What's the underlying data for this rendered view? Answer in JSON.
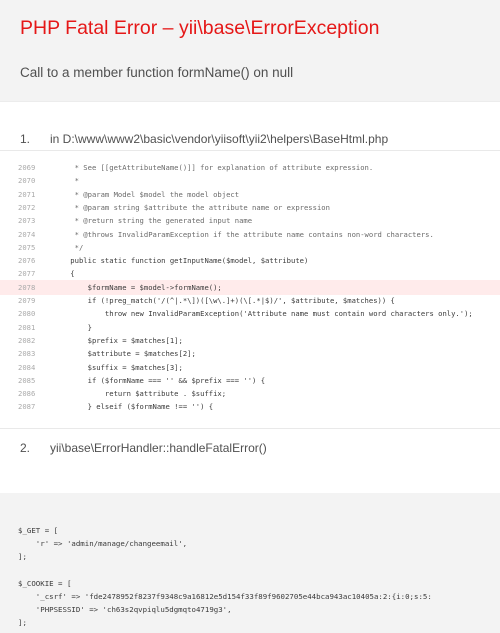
{
  "header": {
    "title": "PHP Fatal Error – yii\\base\\ErrorException",
    "message": "Call to a member function formName() on null"
  },
  "callstack": [
    {
      "num": "1.",
      "text": "in D:\\www\\www2\\basic\\vendor\\yiisoft\\yii2\\helpers\\BaseHtml.php"
    },
    {
      "num": "2.",
      "text": "yii\\base\\ErrorHandler::handleFatalError()"
    }
  ],
  "code_lines": [
    {
      "ln": "2069",
      "src": "     * See [[getAttributeName()]] for explanation of attribute expression."
    },
    {
      "ln": "2070",
      "src": "     *"
    },
    {
      "ln": "2071",
      "src": "     * @param Model $model the model object"
    },
    {
      "ln": "2072",
      "src": "     * @param string $attribute the attribute name or expression"
    },
    {
      "ln": "2073",
      "src": "     * @return string the generated input name"
    },
    {
      "ln": "2074",
      "src": "     * @throws InvalidParamException if the attribute name contains non-word characters."
    },
    {
      "ln": "2075",
      "src": "     */"
    },
    {
      "ln": "2076",
      "src": "    public static function getInputName($model, $attribute)"
    },
    {
      "ln": "2077",
      "src": "    {"
    },
    {
      "ln": "2078",
      "src": "        $formName = $model->formName();"
    },
    {
      "ln": "2079",
      "src": "        if (!preg_match('/(^|.*\\])([\\w\\.]+)(\\[.*|$)/', $attribute, $matches)) {"
    },
    {
      "ln": "2080",
      "src": "            throw new InvalidParamException('Attribute name must contain word characters only.');"
    },
    {
      "ln": "2081",
      "src": "        }"
    },
    {
      "ln": "2082",
      "src": "        $prefix = $matches[1];"
    },
    {
      "ln": "2083",
      "src": "        $attribute = $matches[2];"
    },
    {
      "ln": "2084",
      "src": "        $suffix = $matches[3];"
    },
    {
      "ln": "2085",
      "src": "        if ($formName === '' && $prefix === '') {"
    },
    {
      "ln": "2086",
      "src": "            return $attribute . $suffix;"
    },
    {
      "ln": "2087",
      "src": "        } elseif ($formName !== '') {"
    }
  ],
  "error_line": "2078",
  "vars_lines": [
    "$_GET = [",
    "    'r' => 'admin/manage/changeemail',",
    "];",
    "",
    "$_COOKIE = [",
    "    '_csrf' => 'fde2478952f8237f9348c9a16812e5d154f33f89f9602705e44bca943ac10405a:2:{i:0;s:5:",
    "    'PHPSESSID' => 'ch63s2qvpiqlu5dgmqto4719g3',",
    "];"
  ]
}
